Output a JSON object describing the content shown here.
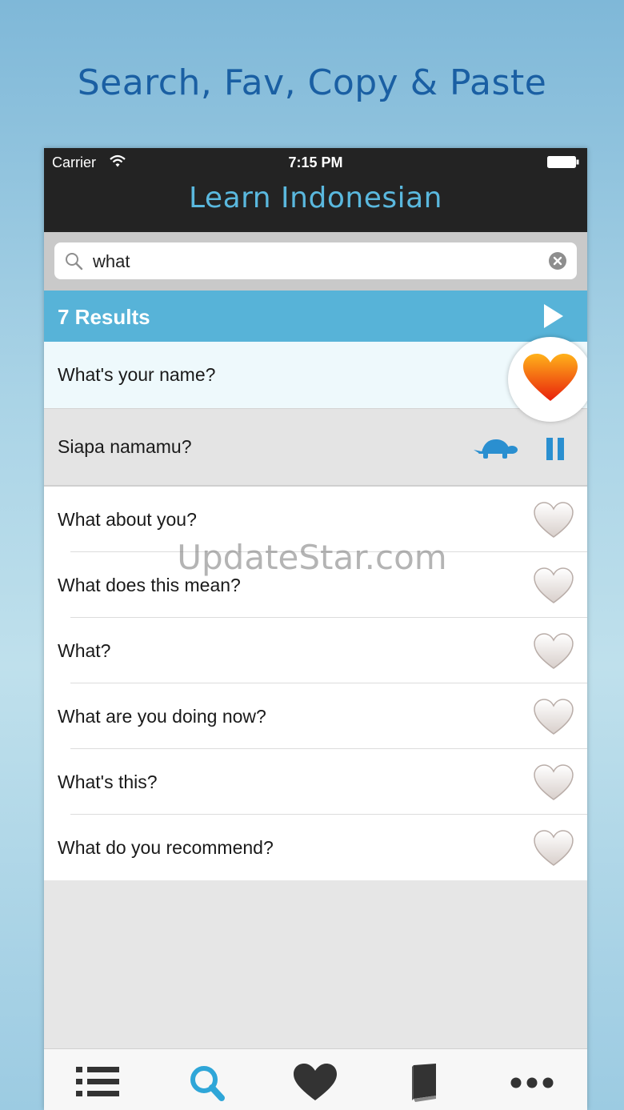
{
  "headline": "Search, Fav, Copy & Paste",
  "status_bar": {
    "carrier": "Carrier",
    "time": "7:15 PM"
  },
  "app_title": "Learn Indonesian",
  "search": {
    "value": "what",
    "placeholder": ""
  },
  "results": {
    "label": "7 Results"
  },
  "selected_phrase": {
    "text": "What's your name?",
    "favorited": true
  },
  "translation": {
    "text": "Siapa namamu?"
  },
  "phrases": [
    {
      "text": "What about you?",
      "favorited": false
    },
    {
      "text": "What does this mean?",
      "favorited": false
    },
    {
      "text": "What?",
      "favorited": false
    },
    {
      "text": "What are you doing now?",
      "favorited": false
    },
    {
      "text": "What's this?",
      "favorited": false
    },
    {
      "text": "What do you recommend?",
      "favorited": false
    }
  ],
  "tabs": [
    {
      "icon": "list-icon",
      "active": false
    },
    {
      "icon": "search-icon",
      "active": true
    },
    {
      "icon": "heart-icon",
      "active": false
    },
    {
      "icon": "book-icon",
      "active": false
    },
    {
      "icon": "more-icon",
      "active": false
    }
  ],
  "watermark": "UpdateStar.com",
  "colors": {
    "accent": "#57b3d8",
    "title": "#5ab8de",
    "headline": "#1a5fa3",
    "nav_bg": "#232323",
    "fav_heart": "#f04a1c"
  }
}
